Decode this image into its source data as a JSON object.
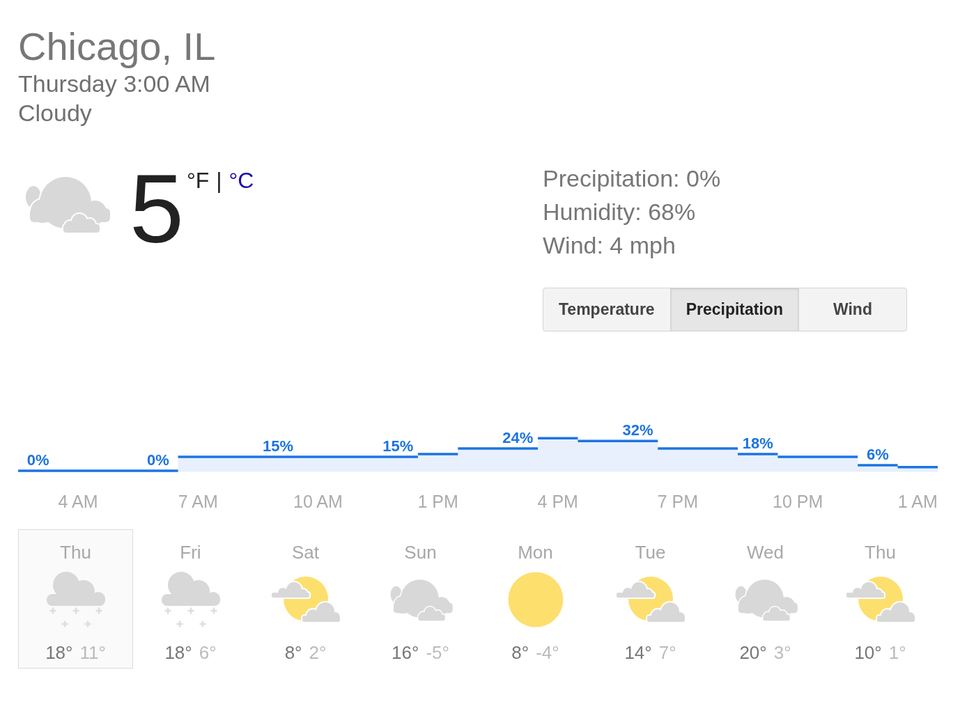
{
  "location": {
    "city": "Chicago, IL",
    "datetime": "Thursday 3:00 AM",
    "condition": "Cloudy"
  },
  "current": {
    "kind": "cloudy",
    "temperature": "5",
    "units": [
      {
        "label": "°F",
        "selected": true
      },
      {
        "label": "°C",
        "selected": false
      }
    ],
    "unit_separator": "|"
  },
  "details": [
    "Precipitation: 0%",
    "Humidity: 68%",
    "Wind: 4 mph"
  ],
  "tabs": [
    {
      "label": "Temperature",
      "selected": false
    },
    {
      "label": "Precipitation",
      "selected": true
    },
    {
      "label": "Wind",
      "selected": false
    }
  ],
  "hourly": {
    "value_labels": [
      "0%",
      "0%",
      "15%",
      "15%",
      "24%",
      "32%",
      "18%",
      "6%"
    ],
    "time_labels": [
      "4 AM",
      "7 AM",
      "10 AM",
      "1 PM",
      "4 PM",
      "7 PM",
      "10 PM",
      "1 AM"
    ]
  },
  "daily": [
    {
      "day": "Thu",
      "kind": "snow",
      "high": "18°",
      "low": "11°",
      "selected": true
    },
    {
      "day": "Fri",
      "kind": "snow",
      "high": "18°",
      "low": "6°",
      "selected": false
    },
    {
      "day": "Sat",
      "kind": "partly_cloudy",
      "high": "8°",
      "low": "2°",
      "selected": false
    },
    {
      "day": "Sun",
      "kind": "cloudy",
      "high": "16°",
      "low": "-5°",
      "selected": false
    },
    {
      "day": "Mon",
      "kind": "sunny",
      "high": "8°",
      "low": "-4°",
      "selected": false
    },
    {
      "day": "Tue",
      "kind": "partly_cloudy",
      "high": "14°",
      "low": "7°",
      "selected": false
    },
    {
      "day": "Wed",
      "kind": "cloudy",
      "high": "20°",
      "low": "3°",
      "selected": false
    },
    {
      "day": "Thu",
      "kind": "partly_cloudy",
      "high": "10°",
      "low": "1°",
      "selected": false
    }
  ]
}
